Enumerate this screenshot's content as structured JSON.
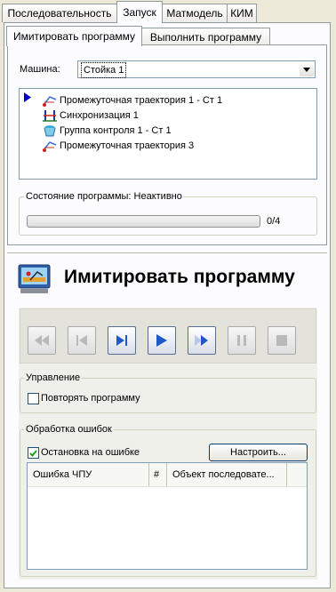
{
  "tabs": [
    {
      "label": "Последовательность"
    },
    {
      "label": "Запуск"
    },
    {
      "label": "Матмодель"
    },
    {
      "label": "КИМ"
    }
  ],
  "subtabs": [
    {
      "label": "Имитировать программу"
    },
    {
      "label": "Выполнить программу"
    }
  ],
  "machine": {
    "label": "Машина:",
    "value": "Стойка 1"
  },
  "tree": {
    "items": [
      {
        "label": "Промежуточная траектория 1 - Ст 1",
        "icon": "toolpath-icon"
      },
      {
        "label": "Синхронизация 1",
        "icon": "sync-icon"
      },
      {
        "label": "Группа контроля 1 - Ст 1",
        "icon": "inspection-group-icon"
      },
      {
        "label": "Промежуточная траектория 3",
        "icon": "toolpath-icon"
      }
    ]
  },
  "status": {
    "label": "Состояние программы: Неактивно",
    "progress_text": "0/4",
    "progress_fraction": 0
  },
  "simulate": {
    "title": "Имитировать программу"
  },
  "playback": [
    {
      "name": "rewind",
      "enabled": false
    },
    {
      "name": "step-back",
      "enabled": false
    },
    {
      "name": "step-forward",
      "enabled": true
    },
    {
      "name": "play",
      "enabled": true
    },
    {
      "name": "fast-forward",
      "enabled": true
    },
    {
      "name": "pause",
      "enabled": false
    },
    {
      "name": "stop",
      "enabled": false
    }
  ],
  "control": {
    "label": "Управление",
    "repeat_label": "Повторять программу",
    "repeat_checked": false
  },
  "errors": {
    "label": "Обработка ошибок",
    "stop_on_error_label": "Остановка на ошибке",
    "stop_on_error_checked": true,
    "configure_button": "Настроить...",
    "columns": [
      "Ошибка ЧПУ",
      "#",
      "Объект последовате..."
    ]
  },
  "colors": {
    "accent": "#0000c0",
    "panel": "#fcfcfe",
    "background": "#ece9d8"
  }
}
